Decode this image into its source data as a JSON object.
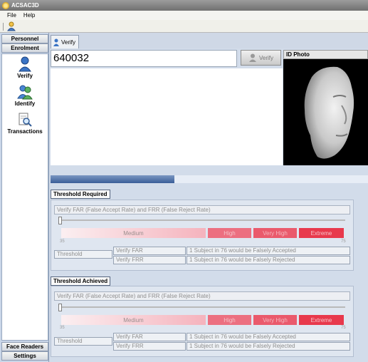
{
  "window": {
    "title": "ACSAC3D"
  },
  "menu": [
    {
      "label": "File"
    },
    {
      "label": "Help"
    }
  ],
  "nav": {
    "sections": [
      {
        "label": "Personnel"
      },
      {
        "label": "Enrolment Station"
      }
    ],
    "items": [
      {
        "label": "Verify",
        "icon": "verify-user-icon"
      },
      {
        "label": "Identify",
        "icon": "identify-users-icon"
      },
      {
        "label": "Transactions",
        "icon": "transactions-search-icon"
      }
    ],
    "bottom": [
      {
        "label": "Face Readers"
      },
      {
        "label": "Settings"
      }
    ]
  },
  "tab": {
    "label": "Verify"
  },
  "verify": {
    "id_value": "640032",
    "button_label": "Verify"
  },
  "photo": {
    "title": "ID Photo"
  },
  "progress": {
    "fraction": 0.39
  },
  "threshold_required": {
    "title": "Threshold Required",
    "rate_header": "Verify FAR (False Accept Rate) and FRR (False Reject Rate)",
    "scale_min": "35",
    "scale_max": "75",
    "levels": [
      "Medium",
      "High",
      "Very High",
      "Extreme"
    ],
    "threshold_label": "Threshold",
    "far_label": "Verify FAR",
    "far_value": "1 Subject in 76 would be Falsely Accepted",
    "frr_label": "Verify FRR",
    "frr_value": "1 Subject in 76 would be Falsely Rejected"
  },
  "threshold_achieved": {
    "title": "Threshold Achieved",
    "rate_header": "Verify FAR (False Accept Rate) and FRR (False Reject Rate)",
    "scale_min": "35",
    "scale_max": "75",
    "levels": [
      "Medium",
      "High",
      "Very High",
      "Extreme"
    ],
    "threshold_label": "Threshold",
    "far_label": "Verify FAR",
    "far_value": "1 Subject in 76 would be Falsely Accepted",
    "frr_label": "Verify FRR",
    "frr_value": "1 Subject in 76 would be Falsely Rejected"
  }
}
